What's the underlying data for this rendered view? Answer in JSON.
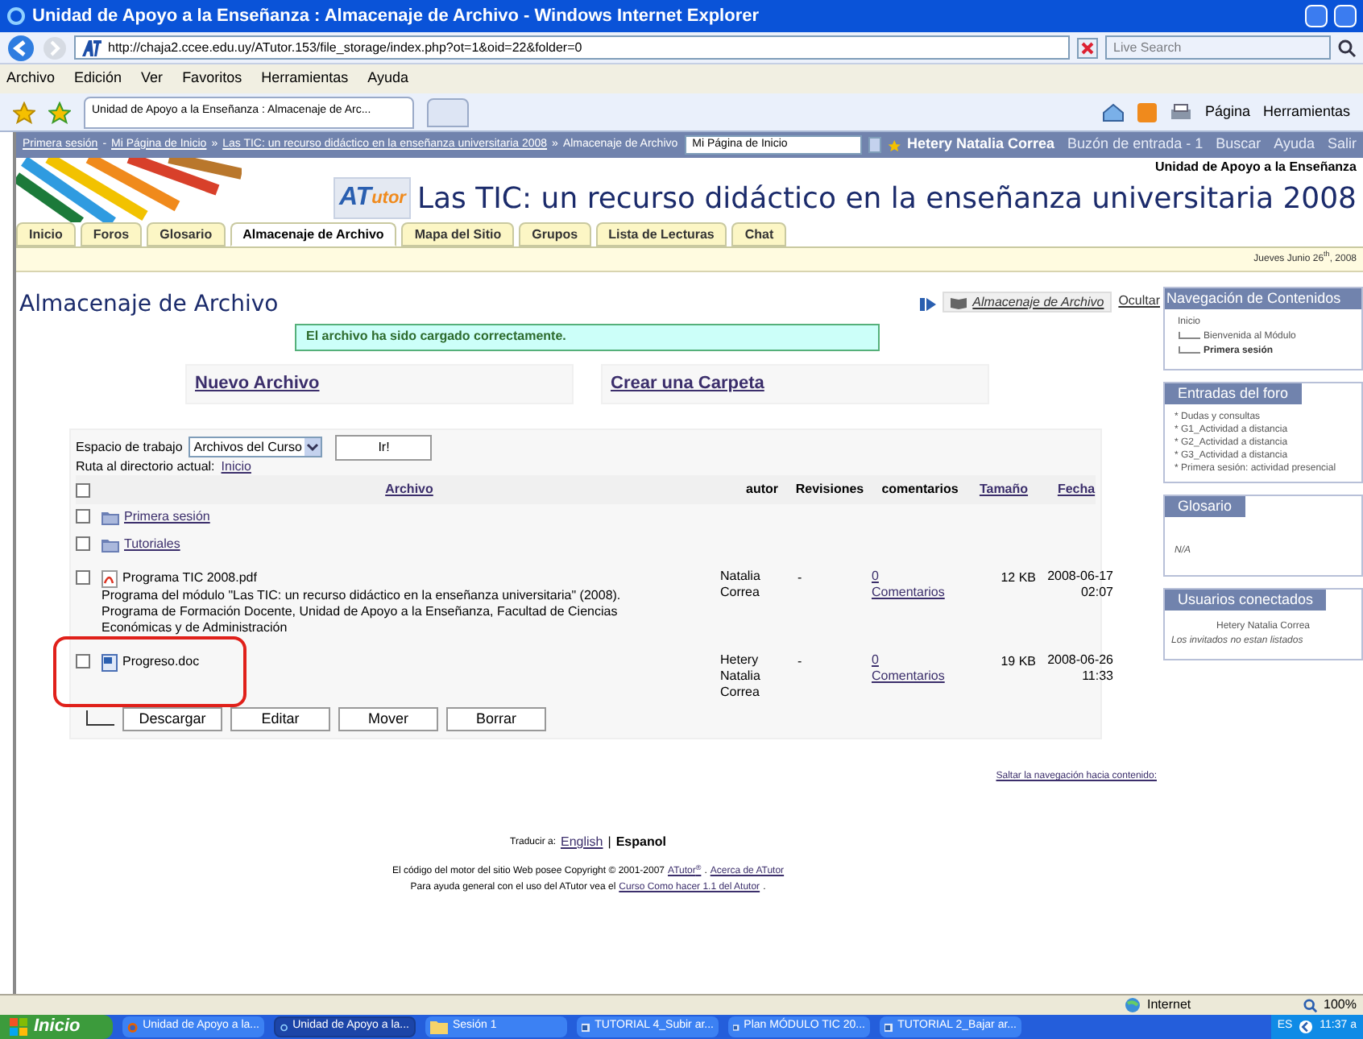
{
  "browser": {
    "title": "Unidad de Apoyo a la Enseñanza : Almacenaje de Archivo - Windows Internet Explorer",
    "address": "http://chaja2.ccee.edu.uy/ATutor.153/file_storage/index.php?ot=1&oid=22&folder=0",
    "search_placeholder": "Live Search",
    "menu": [
      "Archivo",
      "Edición",
      "Ver",
      "Favoritos",
      "Herramientas",
      "Ayuda"
    ],
    "tab": "Unidad de Apoyo a la Enseñanza : Almacenaje de Arc...",
    "toolbar": [
      "Página",
      "Herramientas"
    ]
  },
  "nav_bar": {
    "breadcrumbs": [
      {
        "label": "Primera sesión",
        "link": true
      },
      {
        "label": "-",
        "link": false
      },
      {
        "label": "Mi Página de Inicio",
        "link": true
      },
      {
        "label": "»",
        "link": false
      },
      {
        "label": "Las TIC: un recurso didáctico en la enseñanza universitaria 2008",
        "link": true
      },
      {
        "label": "»",
        "link": false
      },
      {
        "label": "Almacenaje de Archivo",
        "link": false
      }
    ],
    "jump_select": "Mi Página de Inicio",
    "user": "Hetery Natalia Correa",
    "user_links": [
      "Buzón de entrada - 1",
      "Buscar",
      "Ayuda",
      "Salir"
    ]
  },
  "header": {
    "institution": "Unidad de Apoyo a la Enseñanza",
    "logo_text": [
      "AT",
      "utor"
    ],
    "course_title": "Las TIC: un recurso didáctico en la enseñanza universitaria 2008"
  },
  "tabs": [
    {
      "label": "Inicio",
      "selected": false
    },
    {
      "label": "Foros",
      "selected": false
    },
    {
      "label": "Glosario",
      "selected": false
    },
    {
      "label": "Almacenaje de Archivo",
      "selected": true
    },
    {
      "label": "Mapa del Sitio",
      "selected": false
    },
    {
      "label": "Grupos",
      "selected": false
    },
    {
      "label": "Lista de Lecturas",
      "selected": false
    },
    {
      "label": "Chat",
      "selected": false
    }
  ],
  "date": "Jueves Junio 26$^{th}$, 2008",
  "page": {
    "heading": "Almacenaje de Archivo",
    "tool_link": "Almacenaje de Archivo",
    "hide_link": "Ocultar",
    "message": "El archivo ha sido cargado correctamente.",
    "actions": [
      "Nuevo Archivo",
      "Crear una Carpeta"
    ],
    "select_all_checked": false,
    "workspace_label": "Espacio de trabajo",
    "workspace_select": "Archivos del Curso",
    "go_button": "Ir!",
    "path_label": "Ruta al directorio actual:",
    "path_link": "Inicio",
    "columns": [
      {
        "label": "Archivo",
        "link": true
      },
      {
        "label": "autor",
        "link": false
      },
      {
        "label": "Revisiones",
        "link": false
      },
      {
        "label": "comentarios",
        "link": false
      },
      {
        "label": "Tamaño",
        "link": true
      },
      {
        "label": "Fecha",
        "link": true
      }
    ],
    "rows": [
      {
        "kind": "folder",
        "name": "Primera sesión",
        "checked": false,
        "annotated": false
      },
      {
        "kind": "folder",
        "name": "Tutoriales",
        "checked": false,
        "annotated": false
      },
      {
        "kind": "pdf",
        "name": "Programa TIC 2008.pdf",
        "description": "Programa del módulo \"Las TIC: un recurso didáctico en la enseñanza universitaria\" (2008). Programa de Formación Docente, Unidad de Apoyo a la Enseñanza, Facultad de Ciencias Económicas y de Administración",
        "author": [
          "Natalia",
          "Correa"
        ],
        "revisions": "-",
        "comments": [
          "0",
          "Comentarios"
        ],
        "size": "12 KB",
        "date": "2008-06-17",
        "time": "02:07",
        "checked": false,
        "annotated": false
      },
      {
        "kind": "doc",
        "name": "Progreso.doc",
        "author": [
          "Hetery",
          "Natalia",
          "Correa"
        ],
        "revisions": "-",
        "comments": [
          "0",
          "Comentarios"
        ],
        "size": "19 KB",
        "date": "2008-06-26",
        "time": "11:33",
        "checked": false,
        "annotated": true
      }
    ],
    "buttons": [
      "Descargar",
      "Editar",
      "Mover",
      "Borrar"
    ],
    "skip_link": "Saltar la navegación hacia contenido:"
  },
  "footer": {
    "translate_label": "Traducir a:",
    "languages": [
      {
        "label": "English",
        "selected": false
      },
      {
        "label": "Espanol",
        "selected": true
      }
    ],
    "language_separator": "|",
    "lines": [
      [
        {
          "text": "El código del motor del sitio Web posee Copyright © 2001-2007",
          "link": false
        },
        {
          "text": "ATutor$^{®}$",
          "link": true
        },
        {
          "text": ".",
          "link": false
        },
        {
          "text": "Acerca de ATutor",
          "link": true
        }
      ],
      [
        {
          "text": "Para ayuda general con el uso del ATutor vea el",
          "link": false
        },
        {
          "text": "Curso Como hacer 1.1 del Atutor",
          "link": true
        },
        {
          "text": ".",
          "link": false
        }
      ]
    ]
  },
  "sidebar": {
    "nav": {
      "title": "Navegación de Contenidos",
      "root": "Inicio",
      "children": [
        {
          "label": "Bienvenida al Módulo",
          "current": false
        },
        {
          "label": "Primera sesión",
          "current": true
        }
      ]
    },
    "forum": {
      "title": "Entradas del foro",
      "items": [
        "* Dudas y consultas",
        "* G1_Actividad a distancia",
        "* G2_Actividad a distancia",
        "* G3_Actividad a distancia",
        "* Primera sesión: actividad presencial"
      ]
    },
    "glossary": {
      "title": "Glosario",
      "text": "N/A"
    },
    "users": {
      "title": "Usuarios conectados",
      "users": [
        "Hetery Natalia Correa"
      ],
      "note": "Los invitados no estan listados"
    }
  },
  "status_bar": {
    "zone": "Internet",
    "zoom": "100%"
  },
  "taskbar": {
    "start": "Inicio",
    "tasks": [
      {
        "kind": "firefox",
        "label": "Unidad de Apoyo a la...",
        "selected": false
      },
      {
        "kind": "ie",
        "label": "Unidad de Apoyo a la...",
        "selected": true
      },
      {
        "kind": "folder",
        "label": "Sesión 1",
        "selected": false
      },
      {
        "kind": "word",
        "label": "TUTORIAL 4_Subir ar...",
        "selected": false
      },
      {
        "kind": "word",
        "label": "Plan MÓDULO TIC 20...",
        "selected": false
      },
      {
        "kind": "word",
        "label": "TUTORIAL 2_Bajar ar...",
        "selected": false
      }
    ],
    "language": "ES",
    "clock": "11:37 a"
  }
}
